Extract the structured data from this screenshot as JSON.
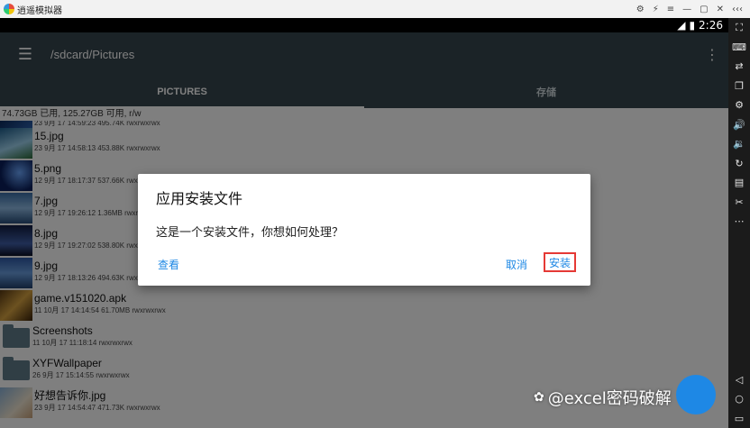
{
  "emulator": {
    "title": "逍遥模拟器",
    "controls": [
      "⚙",
      "⚡",
      "≡",
      "—",
      "▢",
      "✕",
      "‹‹‹"
    ]
  },
  "status_bar": {
    "time": "2:26"
  },
  "sidebar_icons": [
    "resize-icon",
    "keyboard-icon",
    "sync-icon",
    "window-icon",
    "gear-icon",
    "volume-up-icon",
    "volume-down-icon",
    "rotate-icon",
    "folder-icon",
    "scissors-icon",
    "more-icon",
    "back-icon",
    "home-icon",
    "recent-icon"
  ],
  "appbar": {
    "path": "/sdcard/Pictures"
  },
  "tabs": [
    {
      "label": "PICTURES",
      "active": true
    },
    {
      "label": "存储",
      "active": false
    }
  ],
  "storage_info": "74.73GB 已用, 125.27GB 可用, r/w",
  "files": [
    {
      "name": "",
      "meta": "23 9月 17 14:59:23 495.74K rwxrwxrwx",
      "type": "image"
    },
    {
      "name": "15.jpg",
      "meta": "23 9月 17 14:58:13 453.88K rwxrwxrwx",
      "type": "image"
    },
    {
      "name": "5.png",
      "meta": "12 9月 17 18:17:37 537.66K rwxrwxrwx",
      "type": "image"
    },
    {
      "name": "7.jpg",
      "meta": "12 9月 17 19:26:12 1.36MB rwxrwxrwx",
      "type": "image"
    },
    {
      "name": "8.jpg",
      "meta": "12 9月 17 19:27:02 538.80K rwxrwxrwx",
      "type": "image"
    },
    {
      "name": "9.jpg",
      "meta": "12 9月 17 18:13:26 494.63K rwxrwxrwx",
      "type": "image"
    },
    {
      "name": "game.v151020.apk",
      "meta": "11 10月 17 14:14:54 61.70MB rwxrwxrwx",
      "type": "apk"
    },
    {
      "name": "Screenshots",
      "meta": "11 10月 17 11:18:14 rwxrwxrwx",
      "type": "folder"
    },
    {
      "name": "XYFWallpaper",
      "meta": "26 9月 17 15:14:55 rwxrwxrwx",
      "type": "folder"
    },
    {
      "name": "好想告诉你.jpg",
      "meta": "23 9月 17 14:54:47 471.73K rwxrwxrwx",
      "type": "image"
    }
  ],
  "dialog": {
    "title": "应用安装文件",
    "message": "这是一个安装文件，你想如何处理？",
    "view_label": "查看",
    "cancel_label": "取消",
    "install_label": "安装"
  },
  "watermark": "@excel密码破解",
  "colors": {
    "appbar": "#37474f",
    "accent": "#1e88e5",
    "highlight": "#e53935"
  }
}
